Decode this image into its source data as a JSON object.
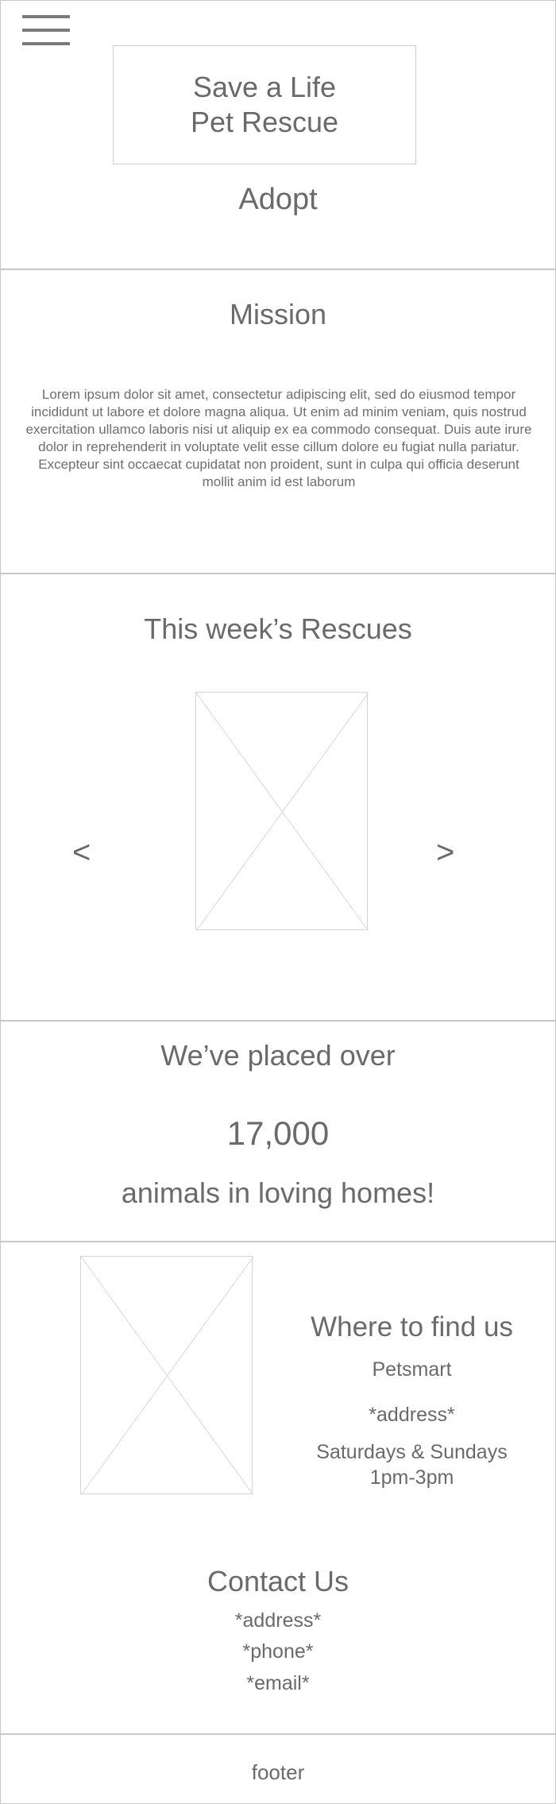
{
  "header": {
    "menu_icon": "hamburger-menu-icon",
    "logo_line1": "Save a Life",
    "logo_line2": "Pet Rescue",
    "adopt_label": "Adopt"
  },
  "mission": {
    "title": "Mission",
    "body": "Lorem ipsum dolor sit amet, consectetur adipiscing elit, sed do eiusmod tempor incididunt ut labore et dolore magna aliqua. Ut enim ad minim veniam, quis nostrud exercitation ullamco laboris nisi ut aliquip ex ea commodo consequat. Duis aute irure dolor in reprehenderit in voluptate velit esse cillum dolore eu fugiat nulla pariatur. Excepteur sint occaecat cupidatat non proident, sunt in culpa qui officia deserunt mollit anim id est laborum"
  },
  "rescues": {
    "title": "This week’s Rescues",
    "prev_label": "<",
    "next_label": ">"
  },
  "stats": {
    "line1": "We’ve placed over",
    "count": "17,000",
    "line2": "animals in loving homes!"
  },
  "location": {
    "title": "Where to find us",
    "place": "Petsmart",
    "address": "*address*",
    "days": "Saturdays & Sundays",
    "hours": "1pm-3pm"
  },
  "contact": {
    "title": "Contact Us",
    "address": "*address*",
    "phone": "*phone*",
    "email": "*email*"
  },
  "footer": {
    "label": "footer"
  },
  "colors": {
    "text": "#666666",
    "border": "#c8c8c8",
    "menu_bars": "#7a7a7a"
  }
}
